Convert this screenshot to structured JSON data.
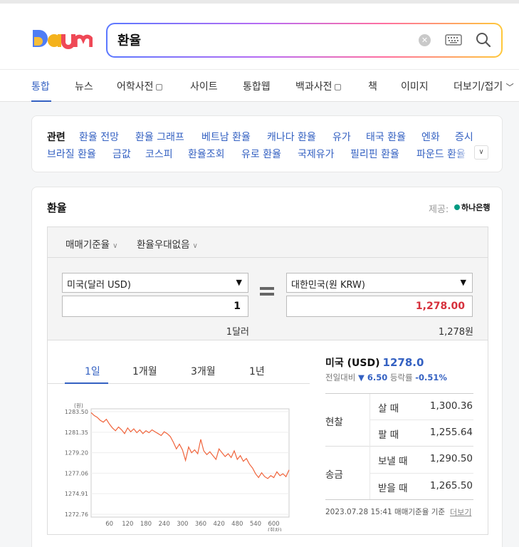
{
  "header": {
    "logo_text": "Daum",
    "search": {
      "value": "환율"
    }
  },
  "tabs": [
    {
      "label": "통합",
      "active": true
    },
    {
      "label": "뉴스"
    },
    {
      "label": "어학사전"
    },
    {
      "label": "사이트"
    },
    {
      "label": "통합웹"
    },
    {
      "label": "백과사전"
    },
    {
      "label": "책"
    },
    {
      "label": "이미지"
    },
    {
      "label": "더보기/접기"
    }
  ],
  "related": {
    "title": "관련",
    "row1": [
      "환율 전망",
      "환율 그래프",
      "베트남 환율",
      "캐나다 환율",
      "유가",
      "태국 환율",
      "엔화",
      "증시"
    ],
    "row2": [
      "브라질 환율",
      "금값",
      "코스피",
      "환율조회",
      "유로 환율",
      "국제유가",
      "필리핀 환율",
      "파운드 환율"
    ]
  },
  "fx": {
    "title": "환율",
    "provider_label": "제공:",
    "provider_name": "하나은행",
    "options": [
      "매매기준율",
      "환율우대없음"
    ],
    "from": {
      "currency": "미국(달러 USD)",
      "amount": "1",
      "unit_text": "1달러"
    },
    "to": {
      "currency": "대한민국(원 KRW)",
      "amount": "1,278.00",
      "unit_text": "1,278원"
    },
    "period_tabs": [
      "1일",
      "1개월",
      "3개월",
      "1년"
    ],
    "summary": {
      "name": "미국 (USD)",
      "rate": "1278.0",
      "change_label": "전일대비",
      "change_value": "▼ 6.50",
      "pct_label": "등락률",
      "pct_value": "-0.51%"
    },
    "table": {
      "cash_label": "현찰",
      "transfer_label": "송금",
      "rows": [
        {
          "label": "살 때",
          "value": "1,300.36"
        },
        {
          "label": "팔 때",
          "value": "1,255.64"
        },
        {
          "label": "보낼 때",
          "value": "1,290.50"
        },
        {
          "label": "받을 때",
          "value": "1,265.50"
        }
      ]
    },
    "basis": "2023.07.28 15:41 매매기준율 기준",
    "more": "더보기"
  },
  "chart_data": {
    "type": "line",
    "ylabel": "(원)",
    "xlabel": "(회차)",
    "y_ticks": [
      "1283.50",
      "1281.35",
      "1279.20",
      "1277.06",
      "1274.91",
      "1272.76"
    ],
    "x_ticks": [
      "60",
      "120",
      "180",
      "240",
      "300",
      "360",
      "420",
      "480",
      "540",
      "600"
    ],
    "ylim": [
      1272.76,
      1283.5
    ],
    "xlim": [
      0,
      650
    ],
    "color": "#f0643c",
    "series": [
      {
        "x": [
          0,
          10,
          20,
          30,
          40,
          50,
          60,
          70,
          80,
          90,
          100,
          110,
          120,
          130,
          140,
          150,
          160,
          170,
          180,
          190,
          200,
          210,
          220,
          230,
          240,
          250,
          260,
          270,
          280,
          290,
          300,
          310,
          320,
          330,
          340,
          350,
          360,
          370,
          380,
          390,
          400,
          410,
          420,
          430,
          440,
          450,
          460,
          470,
          480,
          490,
          500,
          510,
          520,
          530,
          540,
          550,
          560,
          570,
          580,
          590,
          600,
          610,
          620,
          630,
          640,
          650
        ],
        "y": [
          1283.4,
          1283.1,
          1282.9,
          1282.6,
          1282.4,
          1282.7,
          1282.2,
          1281.8,
          1281.5,
          1281.9,
          1281.6,
          1281.2,
          1281.8,
          1281.4,
          1281.7,
          1281.3,
          1281.6,
          1281.2,
          1281.5,
          1281.3,
          1281.6,
          1281.4,
          1281.2,
          1281.0,
          1281.4,
          1281.2,
          1280.9,
          1280.3,
          1279.6,
          1280.1,
          1279.5,
          1278.4,
          1279.8,
          1279.2,
          1279.5,
          1279.1,
          1280.6,
          1279.4,
          1279.0,
          1279.3,
          1278.9,
          1278.5,
          1279.6,
          1279.2,
          1278.8,
          1279.1,
          1278.7,
          1279.4,
          1278.5,
          1278.9,
          1278.3,
          1278.6,
          1278.0,
          1277.6,
          1277.0,
          1276.6,
          1277.1,
          1276.7,
          1276.5,
          1276.8,
          1276.6,
          1277.2,
          1276.8,
          1277.0,
          1276.7,
          1277.4
        ]
      }
    ]
  }
}
